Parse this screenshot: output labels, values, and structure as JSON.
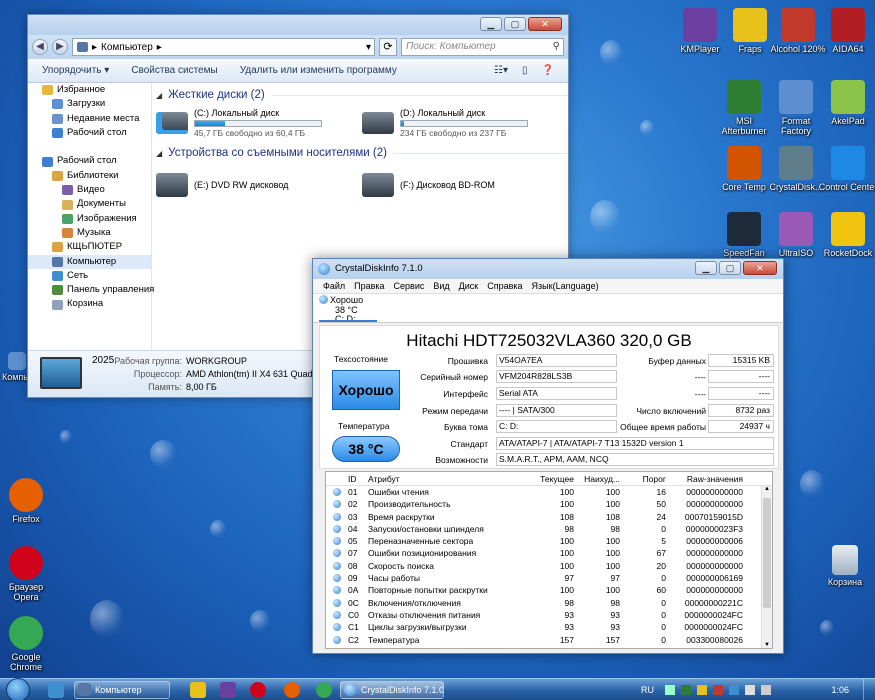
{
  "desktop": {
    "icons_right": [
      {
        "label": "KMPlayer",
        "color": "#6b3fa0"
      },
      {
        "label": "Fraps",
        "color": "#e8c21a"
      },
      {
        "label": "Alcohol 120%",
        "color": "#c0392b"
      },
      {
        "label": "AIDA64",
        "color": "#b01e23"
      },
      {
        "label": "MSI Afterburner",
        "color": "#2e7d32"
      },
      {
        "label": "Format Factory",
        "color": "#5d8fd0"
      },
      {
        "label": "AkelPad",
        "color": "#8bc34a"
      },
      {
        "label": "Core Temp",
        "color": "#d35400"
      },
      {
        "label": "CrystalDisk...",
        "color": "#607d8b"
      },
      {
        "label": "Control Center",
        "color": "#1e88e5"
      },
      {
        "label": "SpeedFan",
        "color": "#1c2a3a"
      },
      {
        "label": "UltraISO",
        "color": "#9b59b6"
      },
      {
        "label": "RocketDock",
        "color": "#f1c40f"
      }
    ],
    "icons_left": [
      {
        "label": "Firefox",
        "color": "#e66000"
      },
      {
        "label": "Браузер Opera",
        "color": "#d0021b"
      },
      {
        "label": "Google Chrome",
        "color": "#34a853"
      }
    ],
    "left_partial": "Компь",
    "recycle_bin": "Корзина"
  },
  "explorer": {
    "address": "Компьютер",
    "search_placeholder": "Поиск: Компьютер",
    "commands": [
      "Упорядочить ▾",
      "Свойства системы",
      "Удалить или изменить программу"
    ],
    "nav": [
      {
        "label": "Избранное",
        "indent": 0,
        "color": "#e7b73a",
        "selected": false
      },
      {
        "label": "Загрузки",
        "indent": 1,
        "color": "#5b8fd6",
        "selected": false
      },
      {
        "label": "Недавние места",
        "indent": 1,
        "color": "#6a93c9",
        "selected": false
      },
      {
        "label": "Рабочий стол",
        "indent": 1,
        "color": "#3f7fd0",
        "selected": false
      },
      {
        "label": "",
        "indent": 0,
        "color": "",
        "selected": false
      },
      {
        "label": "Рабочий стол",
        "indent": 0,
        "color": "#3f7fd0",
        "selected": false
      },
      {
        "label": "Библиотеки",
        "indent": 1,
        "color": "#d9a441",
        "selected": false
      },
      {
        "label": "Видео",
        "indent": 2,
        "color": "#7a5ea8",
        "selected": false
      },
      {
        "label": "Документы",
        "indent": 2,
        "color": "#d6b35b",
        "selected": false
      },
      {
        "label": "Изображения",
        "indent": 2,
        "color": "#4aa36a",
        "selected": false
      },
      {
        "label": "Музыка",
        "indent": 2,
        "color": "#d8833b",
        "selected": false
      },
      {
        "label": "КЩЬПЮТЕР",
        "indent": 1,
        "color": "#d9a441",
        "selected": false
      },
      {
        "label": "Компьютер",
        "indent": 1,
        "color": "#5477a8",
        "selected": true
      },
      {
        "label": "Сеть",
        "indent": 1,
        "color": "#3e8ed0",
        "selected": false
      },
      {
        "label": "Панель управления",
        "indent": 1,
        "color": "#4f8a3f",
        "selected": false
      },
      {
        "label": "Корзина",
        "indent": 1,
        "color": "#8fa3b8",
        "selected": false
      }
    ],
    "hdd_group": "Жесткие диски (2)",
    "hdd": [
      {
        "name": "(C:) Локальный диск",
        "free": "45,7 ГБ свободно из 60,4 ГБ",
        "used_fraction": 0.24
      },
      {
        "name": "(D:) Локальный диск",
        "free": "234 ГБ свободно из 237 ГБ",
        "used_fraction": 0.02
      }
    ],
    "removable_group": "Устройства со съемными носителями (2)",
    "removable": [
      {
        "name": "(E:) DVD RW дисковод"
      },
      {
        "name": "(F:) Дисковод BD-ROM"
      }
    ],
    "details": {
      "name": "2025",
      "labels": [
        "Рабочая группа:",
        "Процессор:",
        "Память:"
      ],
      "values": [
        "WORKGROUP",
        "AMD Athlon(tm) II X4 631 Quad-Core",
        "8,00 ГБ"
      ]
    }
  },
  "cdi": {
    "title": "CrystalDiskInfo 7.1.0",
    "menu": [
      "Файл",
      "Правка",
      "Сервис",
      "Вид",
      "Диск",
      "Справка",
      "Язык(Language)"
    ],
    "disk_tab": {
      "status": "Хорошо",
      "temp": "38 °C",
      "letters": "C: D:"
    },
    "model": "Hitachi HDT725032VLA360 320,0 GB",
    "health_label": "Техсостояние",
    "health_value": "Хорошо",
    "temp_label": "Температура",
    "temp_value": "38 °C",
    "fields": {
      "firmware_label": "Прошивка",
      "firmware": "V54OA7EA",
      "serial_label": "Серийный номер",
      "serial": "VFM204R828LS3B",
      "interface_label": "Интерфейс",
      "interface": "Serial ATA",
      "transfer_label": "Режим передачи",
      "transfer": "---- | SATA/300",
      "volume_label": "Буква тома",
      "volume": "C: D:",
      "standard_label": "Стандарт",
      "standard": "ATA/ATAPI-7 | ATA/ATAPI-7 T13 1532D version 1",
      "features_label": "Возможности",
      "features": "S.M.A.R.T., APM, AAM, NCQ",
      "buffer_label": "Буфер данных",
      "buffer": "15315 KB",
      "r1_label": "----",
      "r1": "----",
      "r2_label": "----",
      "r2": "----",
      "power_count_label": "Число включений",
      "power_count": "8732 раз",
      "power_hours_label": "Общее время работы",
      "power_hours": "24937 ч"
    },
    "smart_headers": [
      "",
      "ID",
      "Атрибут",
      "Текущее",
      "Наихуд...",
      "Порог",
      "Raw-значения"
    ],
    "smart_rows": [
      [
        "01",
        "Ошибки чтения",
        "100",
        "100",
        "16",
        "000000000000"
      ],
      [
        "02",
        "Производительность",
        "100",
        "100",
        "50",
        "000000000000"
      ],
      [
        "03",
        "Время раскрутки",
        "108",
        "108",
        "24",
        "00070159015D"
      ],
      [
        "04",
        "Запуски/остановки шпинделя",
        "98",
        "98",
        "0",
        "0000000023F3"
      ],
      [
        "05",
        "Переназначенные сектора",
        "100",
        "100",
        "5",
        "000000000006"
      ],
      [
        "07",
        "Ошибки позиционирования",
        "100",
        "100",
        "67",
        "000000000000"
      ],
      [
        "08",
        "Скорость поиска",
        "100",
        "100",
        "20",
        "000000000000"
      ],
      [
        "09",
        "Часы работы",
        "97",
        "97",
        "0",
        "000000006169"
      ],
      [
        "0A",
        "Повторные попытки раскрутки",
        "100",
        "100",
        "60",
        "000000000000"
      ],
      [
        "0C",
        "Включения/отключения",
        "98",
        "98",
        "0",
        "00000000221C"
      ],
      [
        "C0",
        "Отказы отключения питания",
        "93",
        "93",
        "0",
        "0000000024FC"
      ],
      [
        "C1",
        "Циклы загрузки/выгрузки",
        "93",
        "93",
        "0",
        "0000000024FC"
      ],
      [
        "C2",
        "Температура",
        "157",
        "157",
        "0",
        "003300080026"
      ]
    ]
  },
  "taskbar": {
    "explorer_btn": "Компьютер",
    "cdi_btn": "CrystalDiskInfo 7.1.0",
    "lang": "RU",
    "time": "1:06"
  }
}
